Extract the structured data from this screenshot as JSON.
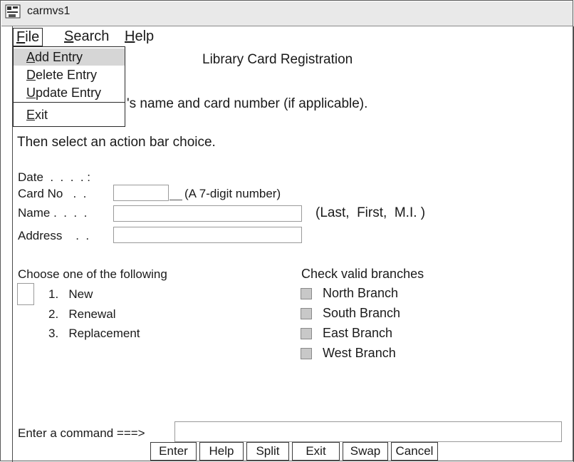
{
  "window": {
    "title": "carmvs1"
  },
  "menu": {
    "items": [
      {
        "label": "File",
        "mnemonic_rest": "ile",
        "mnemonic": "F"
      },
      {
        "label": "Search",
        "mnemonic_rest": "earch",
        "mnemonic": "S"
      },
      {
        "label": "Help",
        "mnemonic_rest": "elp",
        "mnemonic": "H"
      }
    ],
    "file_dropdown": {
      "items": [
        {
          "mnemonic": "A",
          "rest": "dd Entry"
        },
        {
          "mnemonic": "D",
          "rest": "elete Entry"
        },
        {
          "mnemonic": "U",
          "rest": "pdate Entry"
        },
        {
          "mnemonic": "E",
          "rest": "xit"
        }
      ]
    }
  },
  "form": {
    "heading": "Library Card Registration",
    "instruction_line1": "'s name and card number (if applicable).",
    "instruction_line2": "Then select an action bar choice.",
    "date_label": "Date  .  .  .  . :",
    "card_label": "Card No   .  .",
    "card_hint": "(A 7-digit number)",
    "name_label": "Name .  .  .  .",
    "name_hint": "(Last,  First,  M.I. )",
    "address_label": "Address    .  .",
    "choose_heading": "Choose one of the following",
    "choices": [
      "1.   New",
      "2.   Renewal",
      "3.   Replacement"
    ],
    "branches_heading": "Check valid branches",
    "branches": [
      "North Branch",
      "South Branch",
      "East Branch",
      "West Branch"
    ]
  },
  "command": {
    "label": "Enter a command ===>",
    "value": ""
  },
  "buttons": [
    "Enter",
    "Help",
    "Split",
    "Exit",
    "Swap",
    "Cancel"
  ]
}
